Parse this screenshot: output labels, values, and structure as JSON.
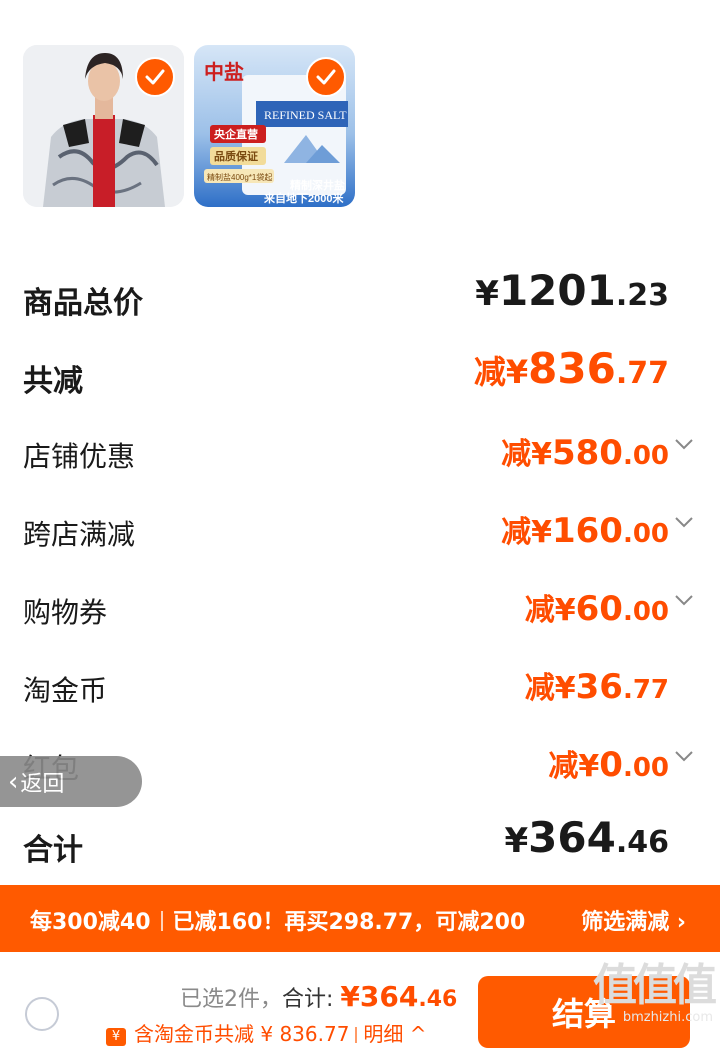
{
  "products": [
    {
      "name": "product-jacket",
      "selected": true
    },
    {
      "name": "product-salt",
      "selected": true,
      "badges": [
        "中盐",
        "央企直营",
        "品质保证",
        "精制盐400g*1袋起",
        "REFINED SALT",
        "精制深井盐",
        "来自地下2000米"
      ]
    }
  ],
  "summary_rows": [
    {
      "label": "商品总价",
      "prefix": "",
      "currency": "¥",
      "int": "1201",
      "dec": ".23",
      "bold": true,
      "style": "black",
      "chevron": false
    },
    {
      "label": "共减",
      "prefix": "减",
      "currency": "¥",
      "int": "836",
      "dec": ".77",
      "bold": true,
      "style": "big",
      "chevron": false
    },
    {
      "label": "店铺优惠",
      "prefix": "减",
      "currency": "¥",
      "int": "580",
      "dec": ".00",
      "bold": false,
      "style": "normal",
      "chevron": true
    },
    {
      "label": "跨店满减",
      "prefix": "减",
      "currency": "¥",
      "int": "160",
      "dec": ".00",
      "bold": false,
      "style": "normal",
      "chevron": true
    },
    {
      "label": "购物券",
      "prefix": "减",
      "currency": "¥",
      "int": "60",
      "dec": ".00",
      "bold": false,
      "style": "normal",
      "chevron": true
    },
    {
      "label": "淘金币",
      "prefix": "减",
      "currency": "¥",
      "int": "36",
      "dec": ".77",
      "bold": false,
      "style": "normal",
      "chevron": false
    },
    {
      "label": "红包",
      "prefix": "减",
      "currency": "¥",
      "int": "0",
      "dec": ".00",
      "bold": false,
      "style": "normal",
      "chevron": true
    },
    {
      "label": "合计",
      "prefix": "",
      "currency": "¥",
      "int": "364",
      "dec": ".46",
      "bold": true,
      "style": "black",
      "chevron": false
    }
  ],
  "back_button": {
    "label": "返回"
  },
  "promo": {
    "part1": "每300减40",
    "part2": "已减160！再买298.77，可减200",
    "action": "筛选满减"
  },
  "bottom_bar": {
    "selected_text": "已选2件，",
    "total_label": "合计: ",
    "total_currency": "¥",
    "total_int": "364",
    "total_dec": ".46",
    "coins_icon": "¥",
    "coins_text": "含淘金币共减 ¥ 836.77",
    "detail_label": "明细",
    "checkout_label": "结算"
  },
  "watermark": {
    "brand": "值值值",
    "url": "bmzhizhi.com"
  },
  "colors": {
    "accent": "#ff5a00",
    "text": "#1a1a1a",
    "muted": "#8a8a8a"
  }
}
